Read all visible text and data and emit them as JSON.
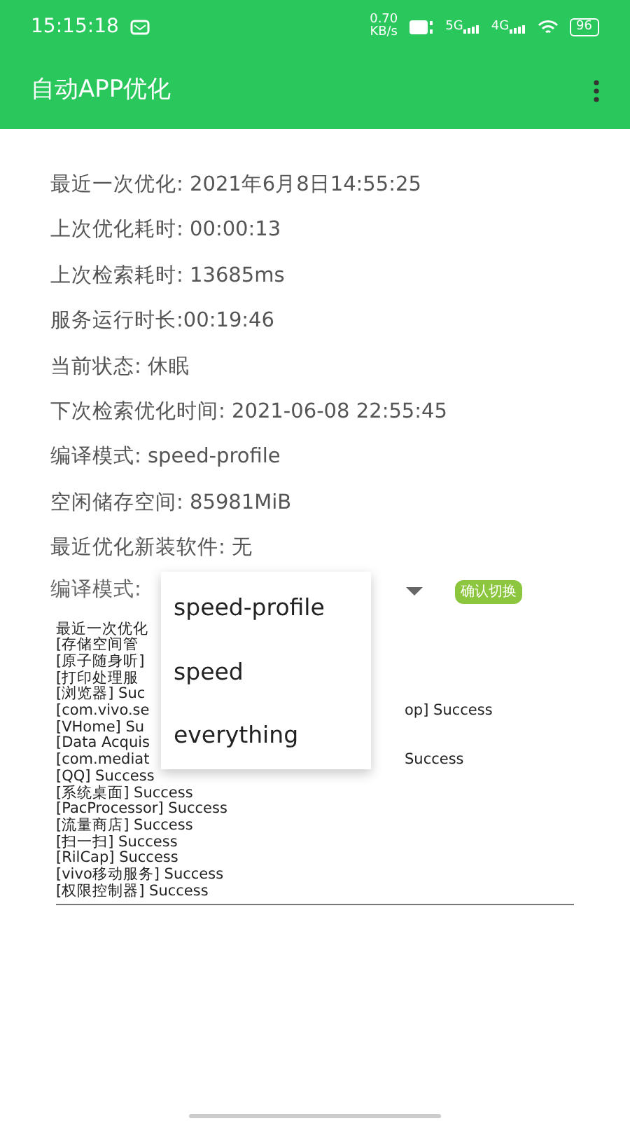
{
  "status_bar": {
    "time": "15:15:18",
    "speed": "0.70",
    "speed_unit": "KB/s",
    "network_1": "5G",
    "network_2": "4G",
    "battery": "96"
  },
  "app_bar": {
    "title": "自动APP优化"
  },
  "info_lines": [
    "最近一次优化: 2021年6月8日14:55:25",
    "上次优化耗时: 00:00:13",
    "上次检索耗时: 13685ms",
    "服务运行时长:00:19:46",
    "当前状态: 休眠",
    "下次检索优化时间: 2021-06-08 22:55:45",
    "编译模式: speed-profile",
    "空闲储存空间: 85981MiB",
    "最近优化新装软件: 无"
  ],
  "mode_row": {
    "label": "编译模式:",
    "button": "确认切换"
  },
  "menu": [
    {
      "label": "speed-profile"
    },
    {
      "label": "speed"
    },
    {
      "label": "everything"
    }
  ],
  "log": [
    {
      "left": "最近一次优化"
    },
    {
      "left": "[存储空间管"
    },
    {
      "left": "[原子随身听]"
    },
    {
      "left": "[打印处理服"
    },
    {
      "left": "[浏览器]  Suc"
    },
    {
      "left": "[com.vivo.se",
      "right": "op]  Success"
    },
    {
      "left": "[VHome]  Su"
    },
    {
      "left": "[Data Acquis"
    },
    {
      "left": "[com.mediat",
      "right": "Success"
    },
    {
      "left": "[QQ]  Success"
    },
    {
      "left": "[系统桌面]  Success"
    },
    {
      "left": "[PacProcessor]  Success"
    },
    {
      "left": "[流量商店]  Success"
    },
    {
      "left": "[扫一扫]  Success"
    },
    {
      "left": "[RilCap]  Success"
    },
    {
      "left": "[vivo移动服务]  Success"
    },
    {
      "left": "[权限控制器]  Success"
    }
  ]
}
